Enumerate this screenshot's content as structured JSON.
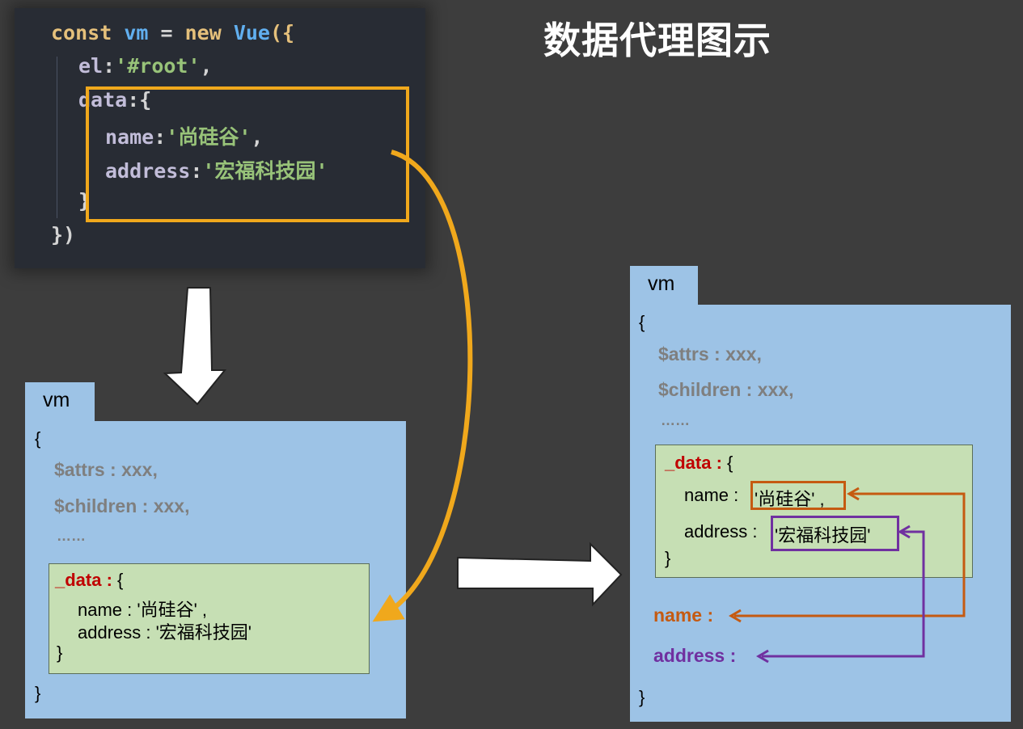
{
  "title": "数据代理图示",
  "code": {
    "line1": {
      "const": "const",
      "vm": "vm",
      "eq": " = ",
      "new": "new",
      "vue": "Vue",
      "open": "({"
    },
    "line2": {
      "key": "el",
      "colon": ":",
      "value": "'#root'",
      "comma": ","
    },
    "line3": {
      "key": "data",
      "rest": ":{"
    },
    "line4": {
      "key": "name",
      "colon": ":",
      "value": "'尚硅谷'",
      "comma": ","
    },
    "line5": {
      "key": "address",
      "colon": ":",
      "value": "'宏福科技园'"
    },
    "line6": "}",
    "line7": "})"
  },
  "left_vm": {
    "tab": "vm",
    "open_brace": "{",
    "attrs": "$attrs : xxx,",
    "children": "$children : xxx,",
    "ellipsis": "……",
    "data_key": "_data :",
    "data_open": " {",
    "name_line": "name : '尚硅谷' ,",
    "address_line": "address : '宏福科技园'",
    "data_close": "}",
    "close_brace": "}"
  },
  "right_vm": {
    "tab": "vm",
    "open_brace": "{",
    "attrs": "$attrs : xxx,",
    "children": "$children : xxx,",
    "ellipsis": "……",
    "data_key": "_data :",
    "data_open": " {",
    "name_key": "name : ",
    "name_value": "'尚硅谷' ,",
    "address_key": "address : ",
    "address_value": "'宏福科技园'",
    "data_close": "}",
    "proxy_name": "name :",
    "proxy_address": "address :",
    "close_brace": "}"
  },
  "colors": {
    "background": "#3d3d3d",
    "vm_box": "#9dc3e6",
    "data_box": "#c6dfb4",
    "highlight": "#f0a81c",
    "name_proxy": "#c55a11",
    "address_proxy": "#7030a0",
    "data_key": "#c00000"
  }
}
